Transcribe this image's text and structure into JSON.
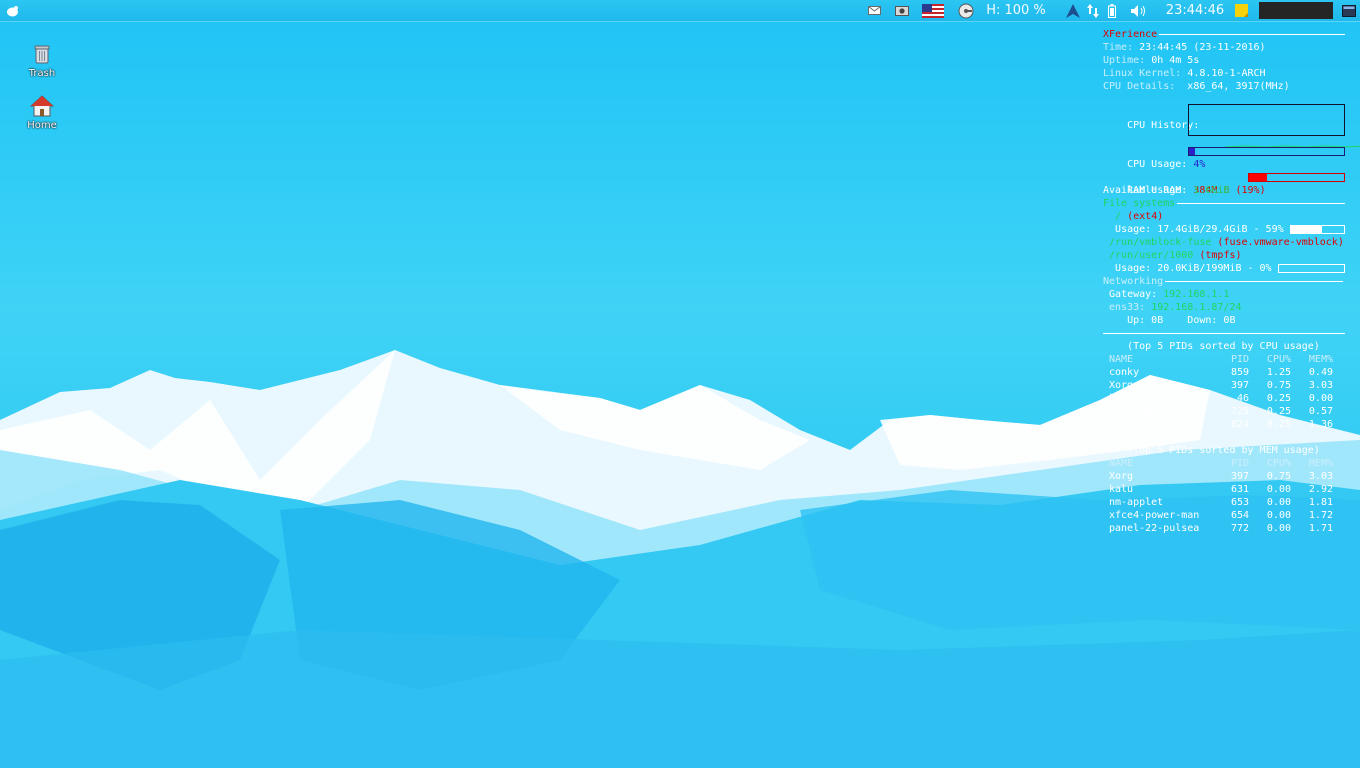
{
  "panel": {
    "hdd": "H: 100 %",
    "clock": "23:44:46"
  },
  "desktop": {
    "icons": [
      {
        "label": "Trash",
        "icon": "trash-icon"
      },
      {
        "label": "Home",
        "icon": "home-icon"
      }
    ]
  },
  "conky": {
    "title": "XFerience",
    "time_label": "Time:",
    "time_value": "23:44:45 (23-11-2016)",
    "uptime_label": "Uptime:",
    "uptime_value": "0h 4m 5s",
    "kernel_label": "Linux Kernel:",
    "kernel_value": "4.8.10-1-ARCH",
    "cpu_details_label": "CPU Details:",
    "cpu_details_value": "x86_64, 3917(MHz)",
    "cpu_history_label": "CPU History:",
    "cpu_usage_label": "CPU Usage:",
    "cpu_usage_value": "4%",
    "cpu_usage_fraction": 0.04,
    "ram_usage_label": "RAM Usage:",
    "ram_usage_value": "384MiB (19%)",
    "ram_usage_fraction": 0.19,
    "avail_ram_label": "Available RAM:",
    "avail_ram_value": "1.6GiB",
    "fs_header": "File systems",
    "fs_root_fstype": "(ext4)",
    "fs_root_mount": "/",
    "fs_root_usage": "Usage: 17.4GiB/29.4GiB - 59%",
    "fs_root_fraction": 0.59,
    "fs_vm_mount": "/run/vmblock-fuse",
    "fs_vm_type": "(fuse.vmware-vmblock)",
    "fs_tmp_mount": "/run/user/1000",
    "fs_tmp_type": "(tmpfs)",
    "fs_tmp_usage": "Usage: 20.0KiB/199MiB - 0%",
    "fs_tmp_fraction": 0.0,
    "net_header": "Networking",
    "gateway_label": "Gateway:",
    "gateway_value": "192.168.1.1",
    "iface_label": "ens33:",
    "iface_value": "192.168.1.87/24",
    "net_updown": "Up: 0B    Down: 0B",
    "top_cpu_title": "(Top 5 PIDs sorted by CPU usage)",
    "top_cpu_headers": [
      "NAME",
      "PID",
      "CPU%",
      "MEM%"
    ],
    "top_cpu_rows": [
      [
        "conky",
        "859",
        "1.25",
        "0.49"
      ],
      [
        "Xorg",
        "397",
        "0.75",
        "3.03"
      ],
      [
        "kworker",
        "46",
        "0.25",
        "0.00"
      ],
      [
        "tearing",
        "725",
        "0.25",
        "0.57"
      ],
      [
        "vmtoolsd",
        "824",
        "0.25",
        "1.36"
      ]
    ],
    "top_mem_title": "(Top 5 PIDs sorted by MEM usage)",
    "top_mem_headers": [
      "NAME",
      "PID",
      "CPU%",
      "MEM%"
    ],
    "top_mem_rows": [
      [
        "Xorg",
        "397",
        "0.75",
        "3.03"
      ],
      [
        "kalu",
        "631",
        "0.00",
        "2.92"
      ],
      [
        "nm-applet",
        "653",
        "0.00",
        "1.81"
      ],
      [
        "xfce4-power-man",
        "654",
        "0.00",
        "1.72"
      ],
      [
        "panel-22-pulsea",
        "772",
        "0.00",
        "1.71"
      ]
    ]
  },
  "colors": {
    "cpu_bar": "#2a22c8",
    "ram_bar": "#ff0000",
    "fs_bar": "#ffffff"
  }
}
